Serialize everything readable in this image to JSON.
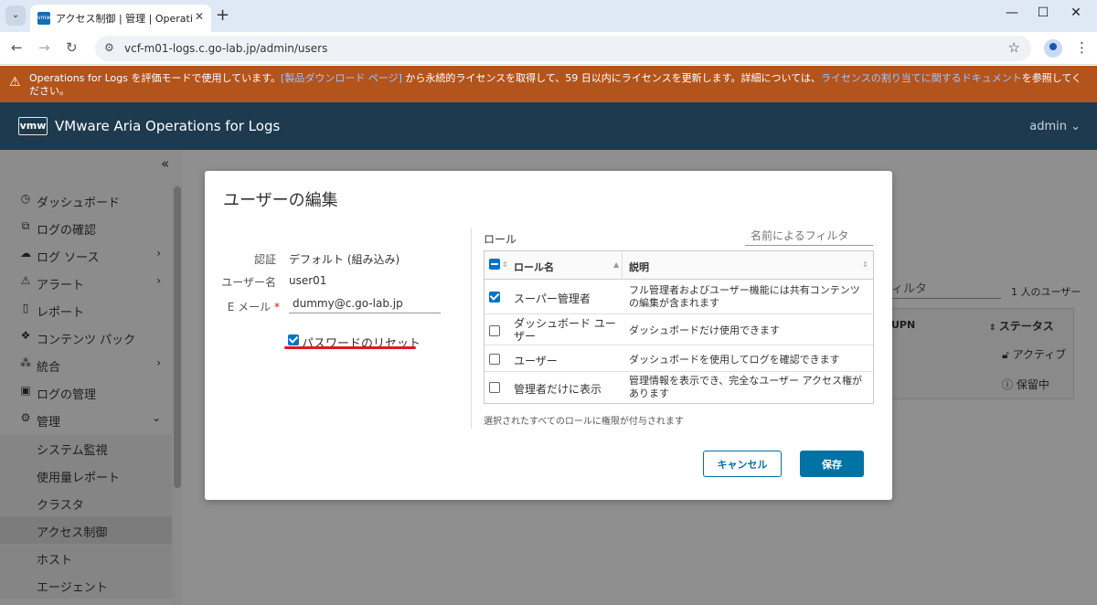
{
  "browser": {
    "tab_title": "アクセス制御 | 管理 | Operations",
    "url": "vcf-m01-logs.c.go-lab.jp/admin/users"
  },
  "banner": {
    "text_pre": "Operations for Logs を評価モードで使用しています。",
    "link1": "[製品ダウンロード ページ]",
    "text_mid": " から永続的ライセンスを取得して、59 日以内にライセンスを更新します。詳細については、",
    "link2": "ライセンスの割り当てに関するドキュメント",
    "text_post": "を参照してください。"
  },
  "header": {
    "logo": "vmw",
    "title": "VMware Aria Operations for Logs",
    "user": "admin"
  },
  "sidebar": {
    "items": [
      {
        "label": "ダッシュボード",
        "icon": "dashboard-icon"
      },
      {
        "label": "ログの確認",
        "icon": "chart-icon"
      },
      {
        "label": "ログ ソース",
        "icon": "cloud-icon"
      },
      {
        "label": "アラート",
        "icon": "warning-icon"
      },
      {
        "label": "レポート",
        "icon": "document-icon"
      },
      {
        "label": "コンテンツ パック",
        "icon": "packs-icon"
      },
      {
        "label": "統合",
        "icon": "network-icon"
      },
      {
        "label": "ログの管理",
        "icon": "log-icon"
      },
      {
        "label": "管理",
        "icon": "gear-icon"
      }
    ],
    "subitems": [
      "システム監視",
      "使用量レポート",
      "クラスタ",
      "アクセス制御",
      "ホスト",
      "エージェント"
    ]
  },
  "background": {
    "filter_placeholder": "ィルタ",
    "user_count": "1 人のユーザー",
    "upn_header": "UPN",
    "status_header": "ステータス",
    "status_active": "アクティブ",
    "status_pending": "保留中"
  },
  "modal": {
    "title": "ユーザーの編集",
    "auth_label": "認証",
    "auth_value": "デフォルト (組み込み)",
    "username_label": "ユーザー名",
    "username_value": "user01",
    "email_label": "E メール",
    "email_value": "dummy@c.go-lab.jp",
    "password_reset_label": "パスワードのリセット",
    "password_reset_checked": true,
    "roles_title": "ロール",
    "role_filter_placeholder": "名前によるフィルタ",
    "role_col_name": "ロール名",
    "role_col_desc": "説明",
    "roles": [
      {
        "name": "スーパー管理者",
        "desc": "フル管理者およびユーザー機能には共有コンテンツの編集が含まれます",
        "checked": true
      },
      {
        "name": "ダッシュボード ユーザー",
        "desc": "ダッシュボードだけ使用できます",
        "checked": false
      },
      {
        "name": "ユーザー",
        "desc": "ダッシュボードを使用してログを確認できます",
        "checked": false
      },
      {
        "name": "管理者だけに表示",
        "desc": "管理情報を表示でき、完全なユーザー アクセス権があります",
        "checked": false
      }
    ],
    "hint": "選択されたすべてのロールに権限が付与されます",
    "cancel_label": "キャンセル",
    "save_label": "保存"
  }
}
